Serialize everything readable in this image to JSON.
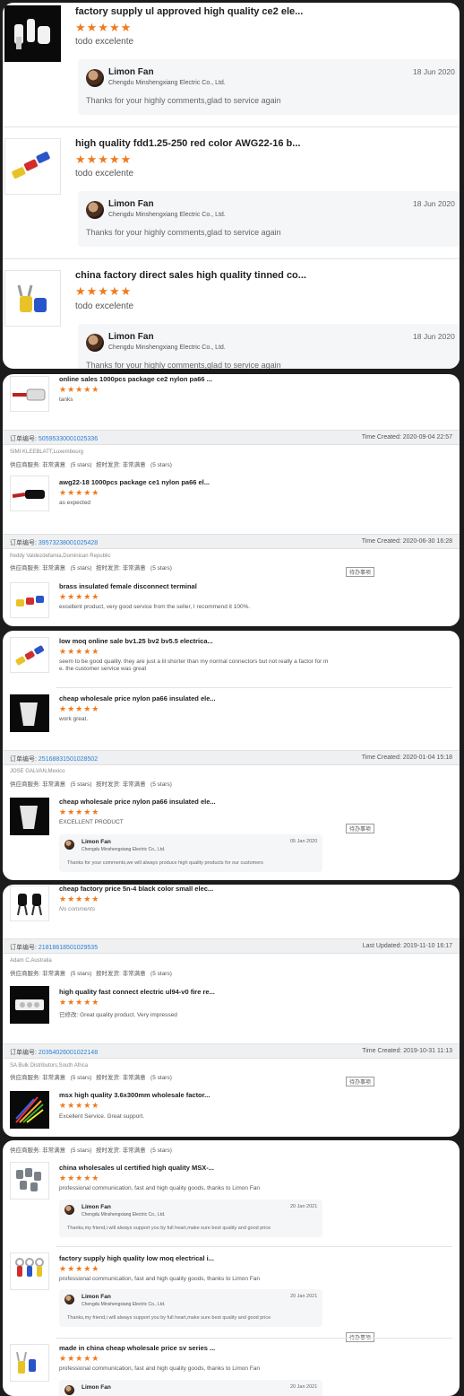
{
  "panel1": {
    "items": [
      {
        "title": "factory supply ul approved high quality ce2 ele...",
        "stars": "★★★★★",
        "review": "todo excelente",
        "reply": {
          "name": "Limon Fan",
          "company": "Chengdu Minshengxiang Electric Co., Ltd.",
          "date": "18 Jun 2020",
          "message": "Thanks for your highly comments,glad to service again"
        }
      },
      {
        "title": "high quality fdd1.25-250 red color AWG22-16 b...",
        "stars": "★★★★★",
        "review": "todo excelente",
        "reply": {
          "name": "Limon Fan",
          "company": "Chengdu Minshengxiang Electric Co., Ltd.",
          "date": "18 Jun 2020",
          "message": "Thanks for your highly comments,glad to service again"
        }
      },
      {
        "title": "china factory direct sales high quality tinned co...",
        "stars": "★★★★★",
        "review": "todo excelente",
        "reply": {
          "name": "Limon Fan",
          "company": "Chengdu Minshengxiang Electric Co., Ltd.",
          "date": "18 Jun 2020",
          "message": "Thanks for your highly comments,glad to service again"
        }
      }
    ]
  },
  "panel2": {
    "item0": {
      "title": "online sales 1000pcs package ce2 nylon pa66 ...",
      "stars": "★★★★★",
      "review": "tanks"
    },
    "order1": {
      "label": "订单编号:",
      "number": "50595330001025336",
      "time": "Time Created: 2020-09-04 22:57",
      "buyer": "SIMI KLEEBLATT,Luxembourg",
      "svc1": "供应商服务: 非常满意",
      "svc1_stars": "(5 stars)",
      "svc2": "按时发货: 非常满意",
      "svc2_stars": "(5 stars)"
    },
    "item1": {
      "title": "awg22-18 1000pcs package ce1 nylon pa66 el...",
      "stars": "★★★★★",
      "review": "as expected"
    },
    "order2": {
      "label": "订单编号:",
      "number": "39573238001025428",
      "time": "Time Created: 2020-06-30 16:28",
      "buyer": "freddy Valdezdefamia,Dominican Republic",
      "svc1": "供应商服务: 非常满意",
      "svc1_stars": "(5 stars)",
      "svc2": "按时发货: 非常满意",
      "svc2_stars": "(5 stars)",
      "todo": "待办事项"
    },
    "item2": {
      "title": "brass insulated female disconnect terminal",
      "stars": "★★★★★",
      "review": "excellent product, very good service from the seller, I recommend it 100%."
    }
  },
  "panel3": {
    "item0": {
      "title": "low moq online sale bv1.25 bv2 bv5.5 electrica...",
      "stars": "★★★★★",
      "review_line1": "seem to be good quality.   they are just a lil shorter than my normal connectors but not really a factor for m",
      "review_line2": "e.   the customer service was great"
    },
    "item1": {
      "title": "cheap wholesale price nylon pa66 insulated ele...",
      "stars": "★★★★★",
      "review": "work great."
    },
    "order": {
      "label": "订单编号:",
      "number": "25168831501028502",
      "time": "Time Created: 2020-01-04 15:18",
      "buyer": "JOSE GALVAN,Mexico",
      "svc1": "供应商服务: 非常满意",
      "svc1_stars": "(5 stars)",
      "svc2": "按时发货: 非常满意",
      "svc2_stars": "(5 stars)"
    },
    "item2": {
      "title": "cheap wholesale price nylon pa66 insulated ele...",
      "stars": "★★★★★",
      "review": "EXCELLENT PRODUCT",
      "todo": "待办事项",
      "reply": {
        "name": "Limon Fan",
        "company": "Chengdu Minshengxiang Electric Co., Ltd.",
        "date": "05 Jan 2020",
        "message": "Thanks for your comments,we will always produce high quality products for our customers"
      }
    }
  },
  "panel4": {
    "item0": {
      "title": "cheap factory price 5n-4 black color small elec...",
      "stars": "★★★★★",
      "review": "No comments"
    },
    "order1": {
      "label": "订单编号:",
      "number": "21818618501029535",
      "time": "Last Updated: 2019-11-10 16:17",
      "buyer": "Adam C,Australia",
      "svc1": "供应商服务: 非常满意",
      "svc1_stars": "(5 stars)",
      "svc2": "按时发货: 非常满意",
      "svc2_stars": "(5 stars)"
    },
    "item1": {
      "title": "high quality fast connect electric ul94-v0 fire re...",
      "stars": "★★★★★",
      "review": "已修改: Great quality product. Very impressed"
    },
    "order2": {
      "label": "订单编号:",
      "number": "20354026001022148",
      "time": "Time Created: 2019-10-31 11:13",
      "buyer": "SA Bulk Distributors,South Africa",
      "svc1": "供应商服务: 非常满意",
      "svc1_stars": "(5 stars)",
      "svc2": "按时发货: 非常满意",
      "svc2_stars": "(5 stars)",
      "todo": "待办事项"
    },
    "item2": {
      "title": "msx high quality 3.6x300mm wholesale factor...",
      "stars": "★★★★★",
      "review": "Excellent Service. Great support."
    }
  },
  "panel5": {
    "svc": {
      "svc1": "供应商服务: 非常满意",
      "svc1_stars": "(5 stars)",
      "svc2": "按时发货: 非常满意",
      "svc2_stars": "(5 stars)"
    },
    "items": [
      {
        "title": "china wholesales ul certified high quality MSX-...",
        "stars": "★★★★★",
        "review": "professional communication, fast and high quality goods, thanks to Limon Fan",
        "reply": {
          "name": "Limon Fan",
          "company": "Chengdu Minshengxiang Electric Co., Ltd.",
          "date": "20 Jan 2021",
          "message": "Thanks,my friend,i will always support you by full heart,make sure best quality and good price"
        }
      },
      {
        "title": "factory supply high quality low moq electrical i...",
        "stars": "★★★★★",
        "review": "professional communication, fast and high quality goods, thanks to Limon Fan",
        "reply": {
          "name": "Limon Fan",
          "company": "Chengdu Minshengxiang Electric Co., Ltd.",
          "date": "20 Jan 2021",
          "message": "Thanks,my friend,i will always support you by full heart,make sure best quality and good price"
        }
      },
      {
        "title": "made in china cheap wholesale price sv series ...",
        "stars": "★★★★★",
        "review": "professional communication, fast and high quality goods, thanks to Limon Fan",
        "todo": "待办事项",
        "reply": {
          "name": "Limon Fan",
          "date": "20 Jan 2021"
        }
      }
    ]
  }
}
